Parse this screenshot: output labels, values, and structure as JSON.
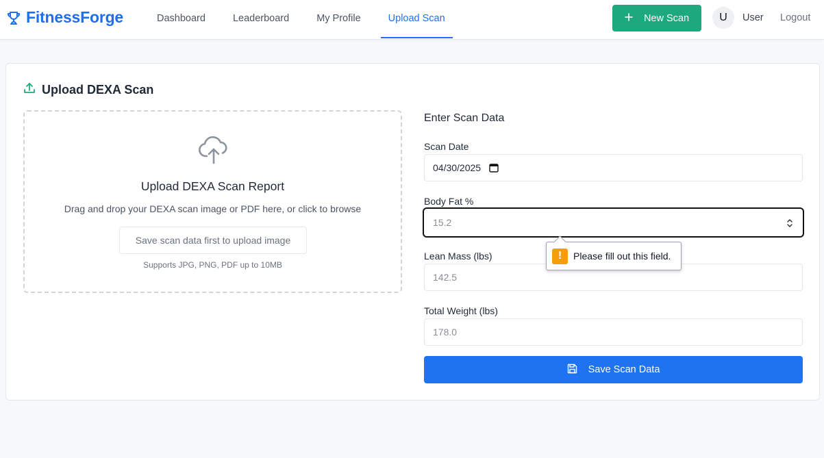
{
  "brand": {
    "name": "FitnessForge",
    "icon": "trophy-icon",
    "color": "#1e6ff0"
  },
  "nav": {
    "items": [
      {
        "label": "Dashboard",
        "active": false
      },
      {
        "label": "Leaderboard",
        "active": false
      },
      {
        "label": "My Profile",
        "active": false
      },
      {
        "label": "Upload Scan",
        "active": true
      }
    ]
  },
  "header": {
    "new_scan_label": "New Scan",
    "new_scan_icon": "plus-icon",
    "new_scan_color": "#1ea97c",
    "avatar_initial": "U",
    "user_name": "User",
    "logout_label": "Logout"
  },
  "card": {
    "title": "Upload DEXA Scan",
    "title_icon": "upload-icon"
  },
  "dropzone": {
    "icon": "cloud-upload-icon",
    "title": "Upload DEXA Scan Report",
    "description": "Drag and drop your DEXA scan image or PDF here, or click to browse",
    "button_label": "Save scan data first to upload image",
    "note": "Supports JPG, PNG, PDF up to 10MB"
  },
  "form": {
    "heading": "Enter Scan Data",
    "scan_date": {
      "label": "Scan Date",
      "value": "04/30/2025",
      "icon": "calendar-icon"
    },
    "body_fat": {
      "label": "Body Fat %",
      "placeholder": "15.2",
      "focused": true
    },
    "lean_mass": {
      "label": "Lean Mass (lbs)",
      "placeholder": "142.5"
    },
    "total_weight": {
      "label": "Total Weight (lbs)",
      "placeholder": "178.0"
    },
    "validation_tooltip": {
      "icon": "warning-icon",
      "text": "Please fill out this field."
    },
    "save_label": "Save Scan Data",
    "save_icon": "floppy-disk-icon",
    "save_color": "#1e73f0"
  }
}
